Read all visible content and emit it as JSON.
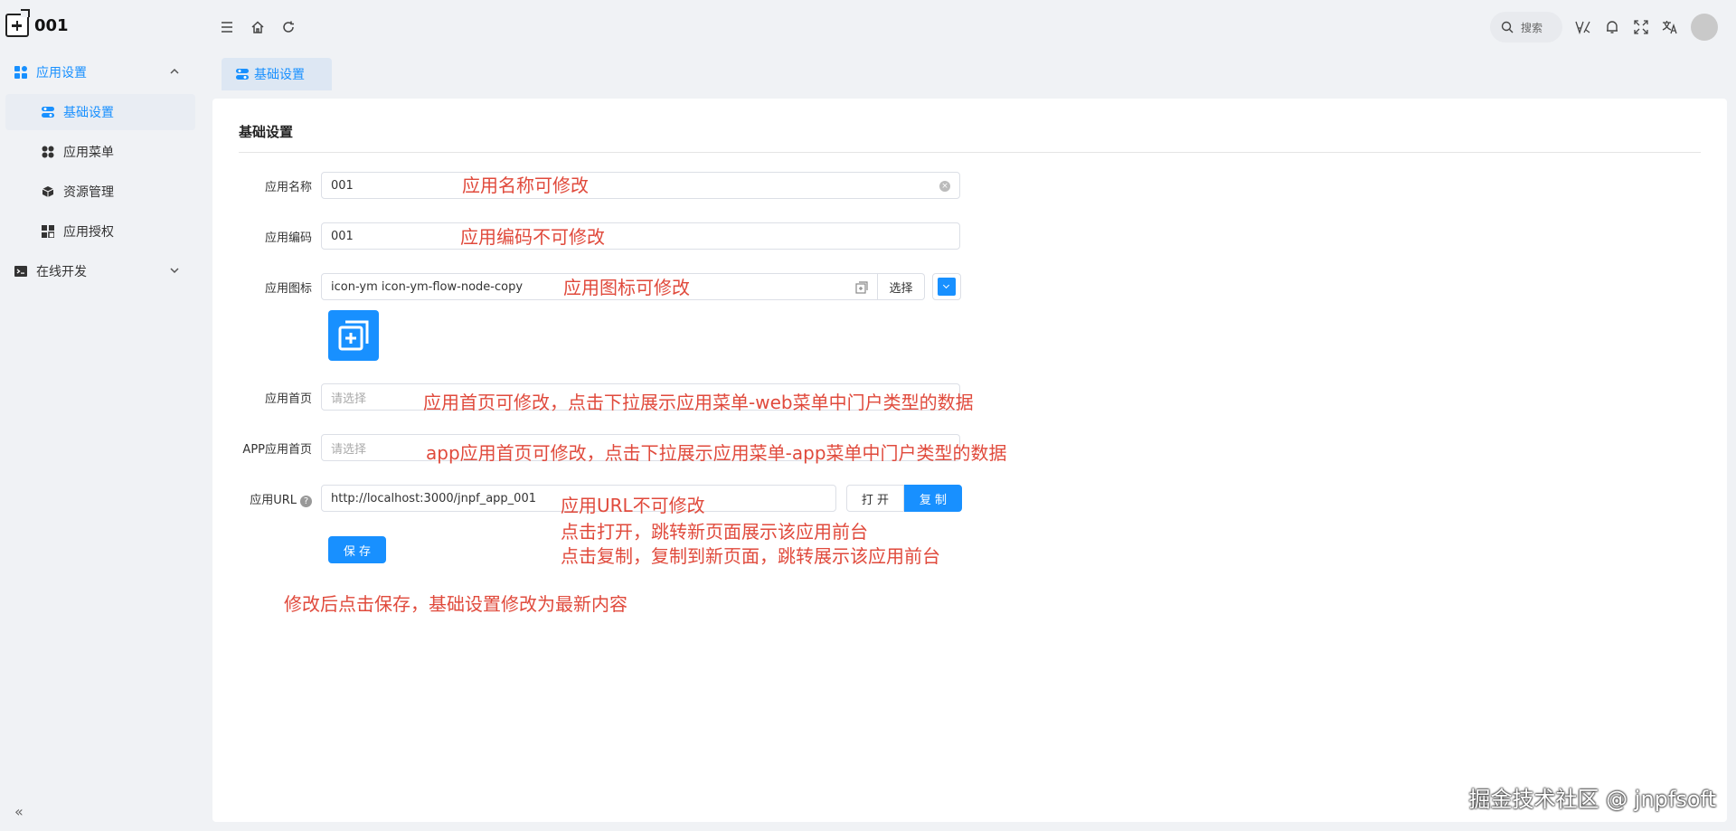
{
  "app": {
    "title": "001"
  },
  "sidebar": {
    "groups": [
      {
        "label": "应用设置",
        "icon": "app-settings-icon",
        "expanded": true,
        "items": [
          {
            "label": "基础设置",
            "icon": "toggle-settings-icon",
            "selected": true
          },
          {
            "label": "应用菜单",
            "icon": "grid-menu-icon"
          },
          {
            "label": "资源管理",
            "icon": "cube-icon"
          },
          {
            "label": "应用授权",
            "icon": "authorize-icon"
          }
        ]
      },
      {
        "label": "在线开发",
        "icon": "terminal-icon",
        "expanded": false
      }
    ],
    "collapse_label": "«"
  },
  "header": {
    "search_placeholder": "搜索"
  },
  "tabs": [
    {
      "label": "基础设置"
    }
  ],
  "panel": {
    "title": "基础设置",
    "fields": {
      "app_name": {
        "label": "应用名称",
        "value": "001"
      },
      "app_code": {
        "label": "应用编码",
        "value": "001"
      },
      "app_icon": {
        "label": "应用图标",
        "value": "icon-ym icon-ym-flow-node-copy",
        "select_button": "选择"
      },
      "home_page": {
        "label": "应用首页",
        "placeholder": "请选择"
      },
      "app_home_page": {
        "label": "APP应用首页",
        "placeholder": "请选择"
      },
      "app_url": {
        "label": "应用URL",
        "value": "http://localhost:3000/jnpf_app_001",
        "open_button": "打 开",
        "copy_button": "复 制"
      }
    },
    "save_button": "保 存"
  },
  "annotations": {
    "name": "应用名称可修改",
    "code": "应用编码不可修改",
    "icon": "应用图标可修改",
    "home": "应用首页可修改，点击下拉展示应用菜单-web菜单中门户类型的数据",
    "app_home": "app应用首页可修改，点击下拉展示应用菜单-app菜单中门户类型的数据",
    "url": "应用URL不可修改",
    "open": "点击打开，跳转新页面展示该应用前台",
    "copy": "点击复制，复制到新页面，跳转展示该应用前台",
    "save": "修改后点击保存，基础设置修改为最新内容"
  },
  "watermark": "掘金技术社区 @ jnpfsoft",
  "colors": {
    "accent": "#1890ff",
    "annotation": "#e04a3c",
    "background": "#f0f2f5"
  }
}
